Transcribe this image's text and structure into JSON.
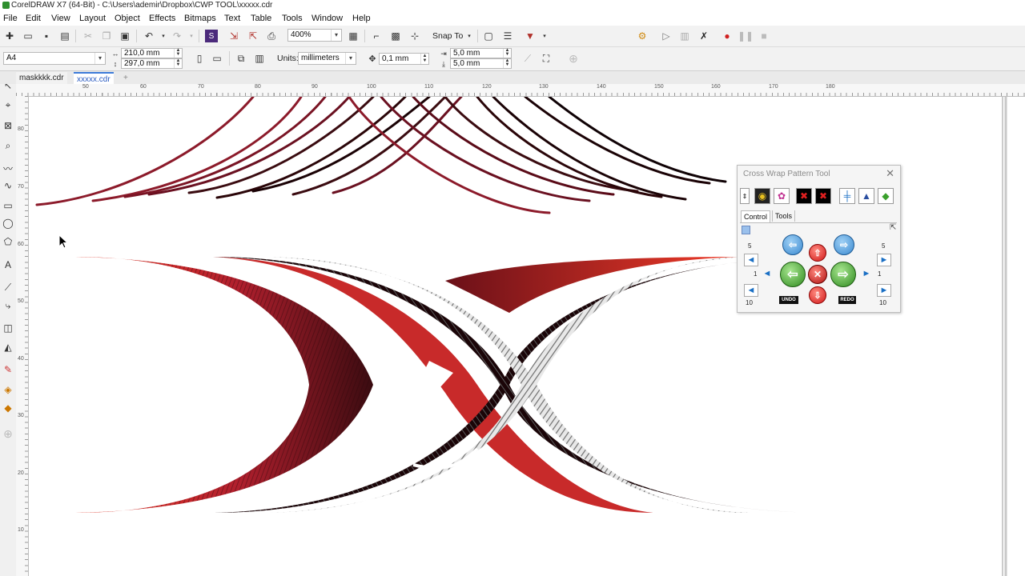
{
  "window": {
    "title": "CorelDRAW X7 (64-Bit) - C:\\Users\\ademir\\Dropbox\\CWP TOOL\\xxxxx.cdr"
  },
  "menu": [
    "File",
    "Edit",
    "View",
    "Layout",
    "Object",
    "Effects",
    "Bitmaps",
    "Text",
    "Table",
    "Tools",
    "Window",
    "Help"
  ],
  "toolbar": {
    "zoom": "400%",
    "snap_to": "Snap To"
  },
  "property_bar": {
    "page_size": "A4",
    "width": "210,0 mm",
    "height": "297,0 mm",
    "units_label": "Units:",
    "units": "millimeters",
    "nudge": "0,1 mm",
    "dup_x": "5,0 mm",
    "dup_y": "5,0 mm"
  },
  "doc_tabs": [
    "maskkkk.cdr",
    "xxxxx.cdr"
  ],
  "ruler": {
    "h_ticks": [
      "50",
      "60",
      "70",
      "80",
      "90",
      "100",
      "110",
      "120",
      "130",
      "140",
      "150",
      "160",
      "170",
      "180"
    ],
    "v_ticks": [
      "80",
      "70",
      "60",
      "50",
      "40",
      "30",
      "20",
      "10"
    ]
  },
  "docker": {
    "title": "Cross Wrap Pattern Tool",
    "tabs": [
      "Control",
      "Tools"
    ],
    "left_top": "5",
    "left_mid": "1",
    "left_bottom": "10",
    "right_top": "5",
    "right_mid": "1",
    "right_bottom": "10",
    "undo": "UNDO",
    "redo": "REDO"
  },
  "colors": {
    "red": "#e02a22",
    "dark_red": "#3a0b10",
    "crimson": "#8c1a2a",
    "silver": "#c9c9c9",
    "green": "#3aa02c",
    "blue": "#3a8ad0"
  }
}
